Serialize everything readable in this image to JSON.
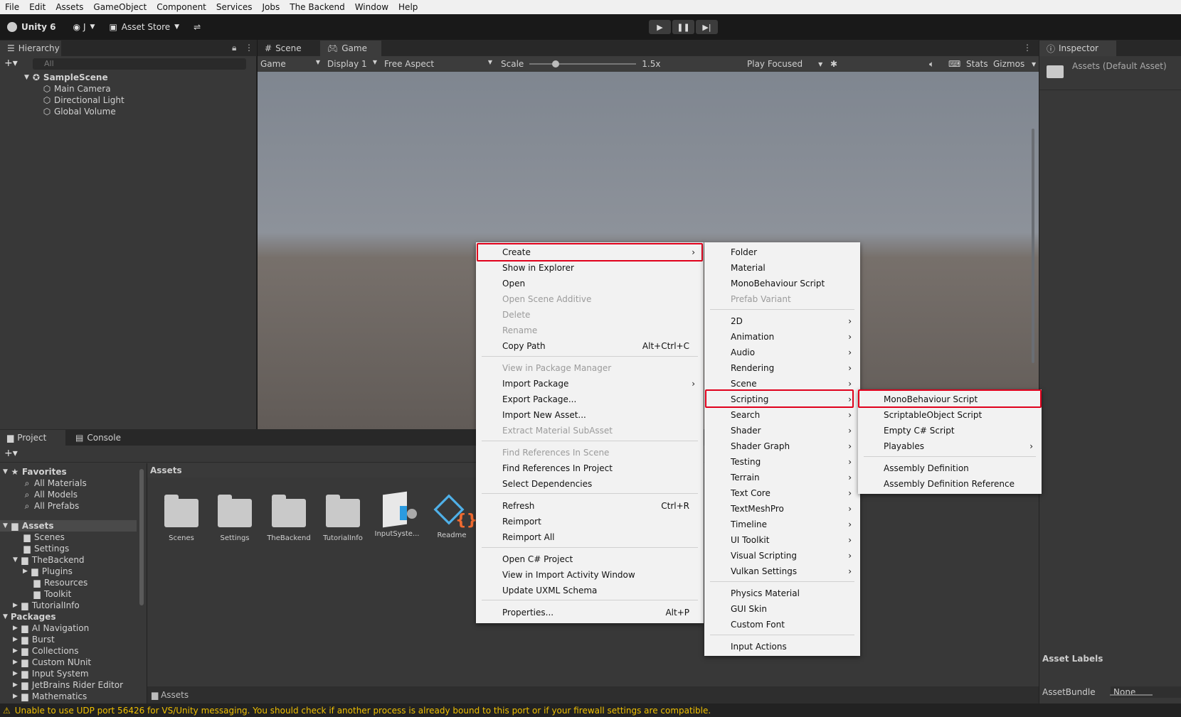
{
  "menubar": [
    "File",
    "Edit",
    "Assets",
    "GameObject",
    "Component",
    "Services",
    "Jobs",
    "The Backend",
    "Window",
    "Help"
  ],
  "toolbar": {
    "unity": "Unity 6",
    "account": "J",
    "asset_store": "Asset Store"
  },
  "hierarchy": {
    "tab": "Hierarchy",
    "search_placeholder": "All",
    "scene": "SampleScene",
    "items": [
      "Main Camera",
      "Directional Light",
      "Global Volume"
    ]
  },
  "scene_tabs": {
    "scene": "Scene",
    "game": "Game"
  },
  "gamebar": {
    "mode": "Game",
    "display": "Display 1",
    "aspect": "Free Aspect",
    "scale_label": "Scale",
    "scale_value": "1.5x",
    "play_focused": "Play Focused",
    "stats": "Stats",
    "gizmos": "Gizmos"
  },
  "inspector": {
    "tab": "Inspector",
    "title": "Assets (Default Asset)",
    "asset_labels": "Asset Labels",
    "assetbundle": "AssetBundle",
    "assetbundle_value": "None"
  },
  "project": {
    "tab_project": "Project",
    "tab_console": "Console",
    "breadcrumb": "Assets",
    "path": "Assets",
    "favorites": "Favorites",
    "fav_items": [
      "All Materials",
      "All Models",
      "All Prefabs"
    ],
    "assets_root": "Assets",
    "assets_children": [
      "Scenes",
      "Settings",
      "TheBackend",
      "Plugins",
      "Resources",
      "Toolkit",
      "TutorialInfo"
    ],
    "packages_root": "Packages",
    "packages": [
      "AI Navigation",
      "Burst",
      "Collections",
      "Custom NUnit",
      "Input System",
      "JetBrains Rider Editor",
      "Mathematics"
    ],
    "grid": [
      "Scenes",
      "Settings",
      "TheBackend",
      "TutorialInfo",
      "InputSyste...",
      "Readme"
    ]
  },
  "status": "Unable to use UDP port 56426 for VS/Unity messaging. You should check if another process is already bound to this port or if your firewall settings are compatible.",
  "menu1": [
    {
      "label": "Create",
      "arrow": true
    },
    {
      "label": "Show in Explorer"
    },
    {
      "label": "Open"
    },
    {
      "label": "Open Scene Additive",
      "disabled": true
    },
    {
      "label": "Delete",
      "disabled": true
    },
    {
      "label": "Rename",
      "disabled": true
    },
    {
      "label": "Copy Path",
      "shortcut": "Alt+Ctrl+C"
    },
    {
      "label": "View in Package Manager",
      "disabled": true
    },
    {
      "label": "Import Package",
      "arrow": true
    },
    {
      "label": "Export Package..."
    },
    {
      "label": "Import New Asset..."
    },
    {
      "label": "Extract Material SubAsset",
      "disabled": true
    },
    {
      "label": "Find References In Scene",
      "disabled": true
    },
    {
      "label": "Find References In Project"
    },
    {
      "label": "Select Dependencies"
    },
    {
      "label": "Refresh",
      "shortcut": "Ctrl+R"
    },
    {
      "label": "Reimport"
    },
    {
      "label": "Reimport All"
    },
    {
      "label": "Open C# Project"
    },
    {
      "label": "View in Import Activity Window"
    },
    {
      "label": "Update UXML Schema"
    },
    {
      "label": "Properties...",
      "shortcut": "Alt+P"
    }
  ],
  "menu2": [
    {
      "label": "Folder"
    },
    {
      "label": "Material"
    },
    {
      "label": "MonoBehaviour Script"
    },
    {
      "label": "Prefab Variant",
      "disabled": true
    },
    {
      "label": "2D",
      "arrow": true
    },
    {
      "label": "Animation",
      "arrow": true
    },
    {
      "label": "Audio",
      "arrow": true
    },
    {
      "label": "Rendering",
      "arrow": true
    },
    {
      "label": "Scene",
      "arrow": true
    },
    {
      "label": "Scripting",
      "arrow": true
    },
    {
      "label": "Search",
      "arrow": true
    },
    {
      "label": "Shader",
      "arrow": true
    },
    {
      "label": "Shader Graph",
      "arrow": true
    },
    {
      "label": "Testing",
      "arrow": true
    },
    {
      "label": "Terrain",
      "arrow": true
    },
    {
      "label": "Text Core",
      "arrow": true
    },
    {
      "label": "TextMeshPro",
      "arrow": true
    },
    {
      "label": "Timeline",
      "arrow": true
    },
    {
      "label": "UI Toolkit",
      "arrow": true
    },
    {
      "label": "Visual Scripting",
      "arrow": true
    },
    {
      "label": "Vulkan Settings",
      "arrow": true
    },
    {
      "label": "Physics Material"
    },
    {
      "label": "GUI Skin"
    },
    {
      "label": "Custom Font"
    },
    {
      "label": "Input Actions"
    }
  ],
  "menu3": [
    {
      "label": "MonoBehaviour Script"
    },
    {
      "label": "ScriptableObject Script"
    },
    {
      "label": "Empty C# Script"
    },
    {
      "label": "Playables",
      "arrow": true
    },
    {
      "label": "Assembly Definition"
    },
    {
      "label": "Assembly Definition Reference"
    }
  ]
}
